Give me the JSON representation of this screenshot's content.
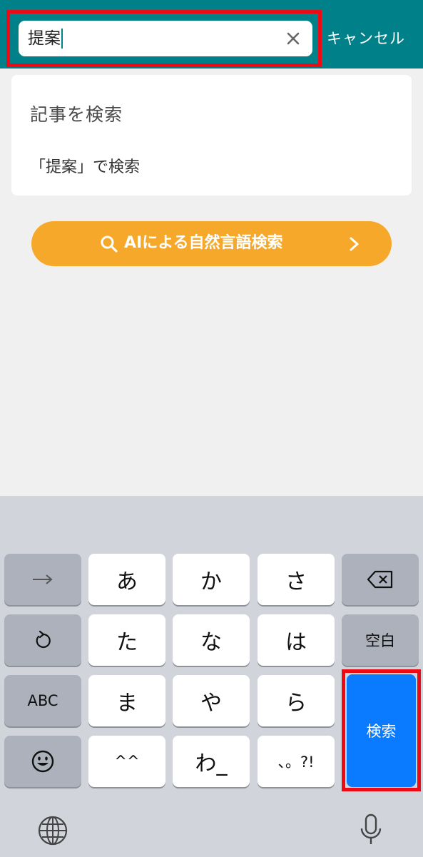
{
  "header": {
    "search_value": "提案",
    "cancel_label": "キャンセル"
  },
  "suggestions": {
    "title": "記事を検索",
    "item_label": "「提案」で検索"
  },
  "ai_button": {
    "label": "AIによる自然言語検索"
  },
  "keyboard": {
    "row1": [
      "あ",
      "か",
      "さ"
    ],
    "row2": [
      "た",
      "な",
      "は"
    ],
    "row3": [
      "ま",
      "や",
      "ら"
    ],
    "row4": [
      "^^",
      "わ_",
      "、。?!"
    ],
    "space_label": "空白",
    "abc_label": "ABC",
    "search_label": "検索"
  },
  "colors": {
    "header_teal": "#00818a",
    "ai_orange": "#f6a82a",
    "search_key_blue": "#0a7aff",
    "highlight_red": "#ee0a14"
  }
}
